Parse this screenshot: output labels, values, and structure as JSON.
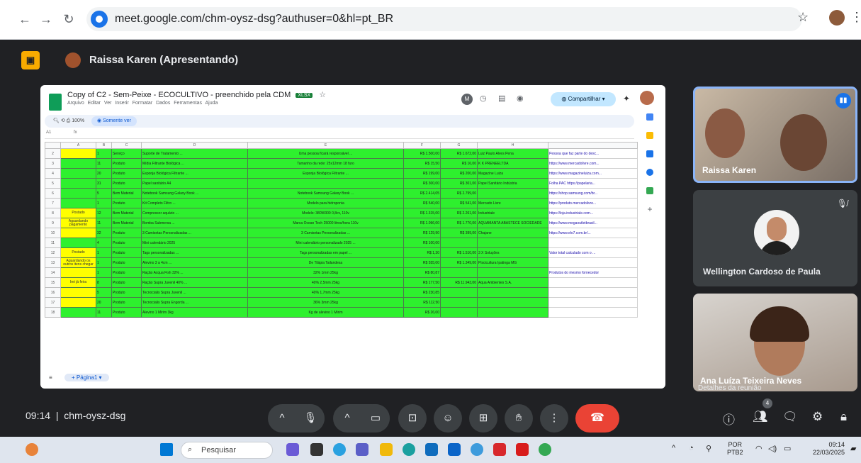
{
  "browser": {
    "url": "meet.google.com/chm-oysz-dsg?authuser=0&hl=pt_BR",
    "back_icon": "arrow-left-icon",
    "forward_icon": "arrow-right-icon",
    "reload_icon": "reload-icon"
  },
  "meet": {
    "presenter_label": "Raissa Karen (Apresentando)",
    "time": "09:14",
    "meeting_code": "chm-oysz-dsg",
    "details_label": "Detalhes da reunião",
    "participant_count": "4"
  },
  "sheet": {
    "title": "Copy of C2 - Sem-Peixe - ECOCULTIVO - preenchido pela CDM",
    "badge": "XLSX",
    "menu": "Arquivo  Editar  Ver  Inserir  Formatar  Dados  Ferramentas  Ajuda",
    "share_label": "Compartilhar",
    "zoom": "100%",
    "mode_label": "Somente ver",
    "cell_ref": "A1",
    "sheet_tab": "Página1",
    "columns": [
      "A",
      "B",
      "C",
      "D",
      "E",
      "F",
      "G",
      "H"
    ],
    "rows": [
      {
        "n": "2",
        "a": "",
        "b": "1",
        "c": "Serviço",
        "d": "Suporte de Tratamento ...",
        "e": "Uma pessoa ficará responsável ...",
        "f": "R$ 1.500,00",
        "g": "R$ 1.672,00",
        "h": "Luiz Paulo Alves Pena",
        "i": "Pessoa que faz parte do desc..."
      },
      {
        "n": "3",
        "a": "",
        "b": "11",
        "c": "Produto",
        "d": "Mídia Filtrante Biológica ...",
        "e": "Tamanho da rede: 25x12mm 18 furo",
        "f": "R$ 15,50",
        "g": "R$ 16,00",
        "h": "K K PRENEELTDA",
        "i": "https://www.mercadolivre.com..."
      },
      {
        "n": "4",
        "a": "",
        "b": "20",
        "c": "Produto",
        "d": "Esponja Biológica Filtrante ...",
        "e": "Esponja Biológica Filtrante ...",
        "f": "R$ 199,00",
        "g": "R$ 200,00",
        "h": "Magazine Luiza",
        "i": "https://www.magazineluiza.com..."
      },
      {
        "n": "5",
        "a": "",
        "b": "31",
        "c": "Produto",
        "d": "Papel sanitário A4",
        "e": "",
        "f": "R$ 300,00",
        "g": "R$ 301,00",
        "h": "Papel Sanitário Indústria",
        "i": "Folha PAC https://papelaria..."
      },
      {
        "n": "6",
        "a": "",
        "b": "5",
        "c": "Bem Material",
        "d": "Notebook Samsung Galaxy Book ...",
        "e": "Notebook Samsung Galaxy Book ...",
        "f": "R$ 2.414,05",
        "g": "R$ 2.799,00",
        "h": "",
        "i": "https://shop.samsung.com/br..."
      },
      {
        "n": "7",
        "a": "",
        "b": "1",
        "c": "Produto",
        "d": "Kit Completo Filtro ...",
        "e": "Modelo para hidroponia",
        "f": "R$ 540,00",
        "g": "R$ 541,00",
        "h": "Mercado Livre",
        "i": "https://produto.mercadolivre..."
      },
      {
        "n": "8",
        "a": "Postado",
        "b": "12",
        "c": "Bem Material",
        "d": "Compressor aquário ...",
        "e": "Modelo: 380W300 0,8cv, 110v",
        "f": "R$ 1.315,00",
        "g": "R$ 2.261,00",
        "h": "Industriale",
        "i": "https://loja.industriale.com..."
      },
      {
        "n": "9",
        "a": "Aguardando pagamento",
        "b": "11",
        "c": "Bem Material",
        "d": "Bomba Submersa ...",
        "e": "Marca Ocean Tech 25000 litros/hora 110v",
        "f": "R$ 1.096,00",
        "g": "R$ 1.770,00",
        "h": "AQUAMANTA ABASTECE SOCIEDADE",
        "i": "https://www.megaoutletbrasil..."
      },
      {
        "n": "10",
        "a": "",
        "b": "32",
        "c": "Produto",
        "d": "3 Camisetas Personalizadas ...",
        "e": "3 Camisetas Personalizadas ...",
        "f": "R$ 129,90",
        "g": "R$ 399,00",
        "h": "Chajane",
        "i": "https://www.elo7.com.br/..."
      },
      {
        "n": "11",
        "a": "",
        "b": "4",
        "c": "Produto",
        "d": "Mini calendário 2025",
        "e": "Mini calendário personalizado 2025 ...",
        "f": "R$ 100,00",
        "g": "",
        "h": "",
        "i": ""
      },
      {
        "n": "12",
        "a": "Postado",
        "b": "1",
        "c": "Produto",
        "d": "Tags personalizadas ...",
        "e": "Tags personalizadas em papel ...",
        "f": "R$ 1,30",
        "g": "R$ 1.510,00",
        "h": "3 X Soluções",
        "i": "Valor total calculado com o ..."
      },
      {
        "n": "13",
        "a": "Aguardando os outros itens chegar",
        "b": "1",
        "c": "Produto",
        "d": "Alevino 3 a 4cm ...",
        "e": "De Tilápia Tailandesa",
        "f": "R$ 555,00",
        "g": "R$ 1.349,00",
        "h": "Piscicultura Ipatinga MG",
        "i": ""
      },
      {
        "n": "14",
        "a": "",
        "b": "1",
        "c": "Produto",
        "d": "Ração Acqua Fish 32% ...",
        "e": "32% 1mm 25kg",
        "f": "R$ 80,87",
        "g": "",
        "h": "",
        "i": "Produtos do mesmo fornecedor"
      },
      {
        "n": "15",
        "a": "Irei já feira",
        "b": "8",
        "c": "Produto",
        "d": "Ração Supra Juvenil 40% ...",
        "e": "40% 2,5mm 25kg",
        "f": "R$ 177,50",
        "g": "R$ 11.943,00",
        "h": "Aqua Ambientes S.A.",
        "i": ""
      },
      {
        "n": "16",
        "a": "",
        "b": "5",
        "c": "Produto",
        "d": "Tecnocialis Supra Juvenil ...",
        "e": "40% 1,7mm 25kg",
        "f": "R$ 230,85",
        "g": "",
        "h": "",
        "i": ""
      },
      {
        "n": "17",
        "a": "",
        "b": "20",
        "c": "Produto",
        "d": "Tecnocialis Supra Engorda ...",
        "e": "36% 3mm 25kg",
        "f": "R$ 112,50",
        "g": "",
        "h": "",
        "i": ""
      },
      {
        "n": "18",
        "a": "",
        "b": "11",
        "c": "Produto",
        "d": "Alevino 1 Mirim 3kg",
        "e": "Kg de alevino 1 Mirim",
        "f": "R$ 26,00",
        "g": "",
        "h": "",
        "i": ""
      }
    ]
  },
  "participants": [
    {
      "name": "Raissa Karen"
    },
    {
      "name": "Wellington Cardoso de Paula"
    },
    {
      "name": "Ana Luíza Teixeira Neves"
    }
  ],
  "taskbar": {
    "search_placeholder": "Pesquisar",
    "lang_line1": "POR",
    "lang_line2": "PTB2",
    "time": "09:14",
    "date": "22/03/2025"
  }
}
